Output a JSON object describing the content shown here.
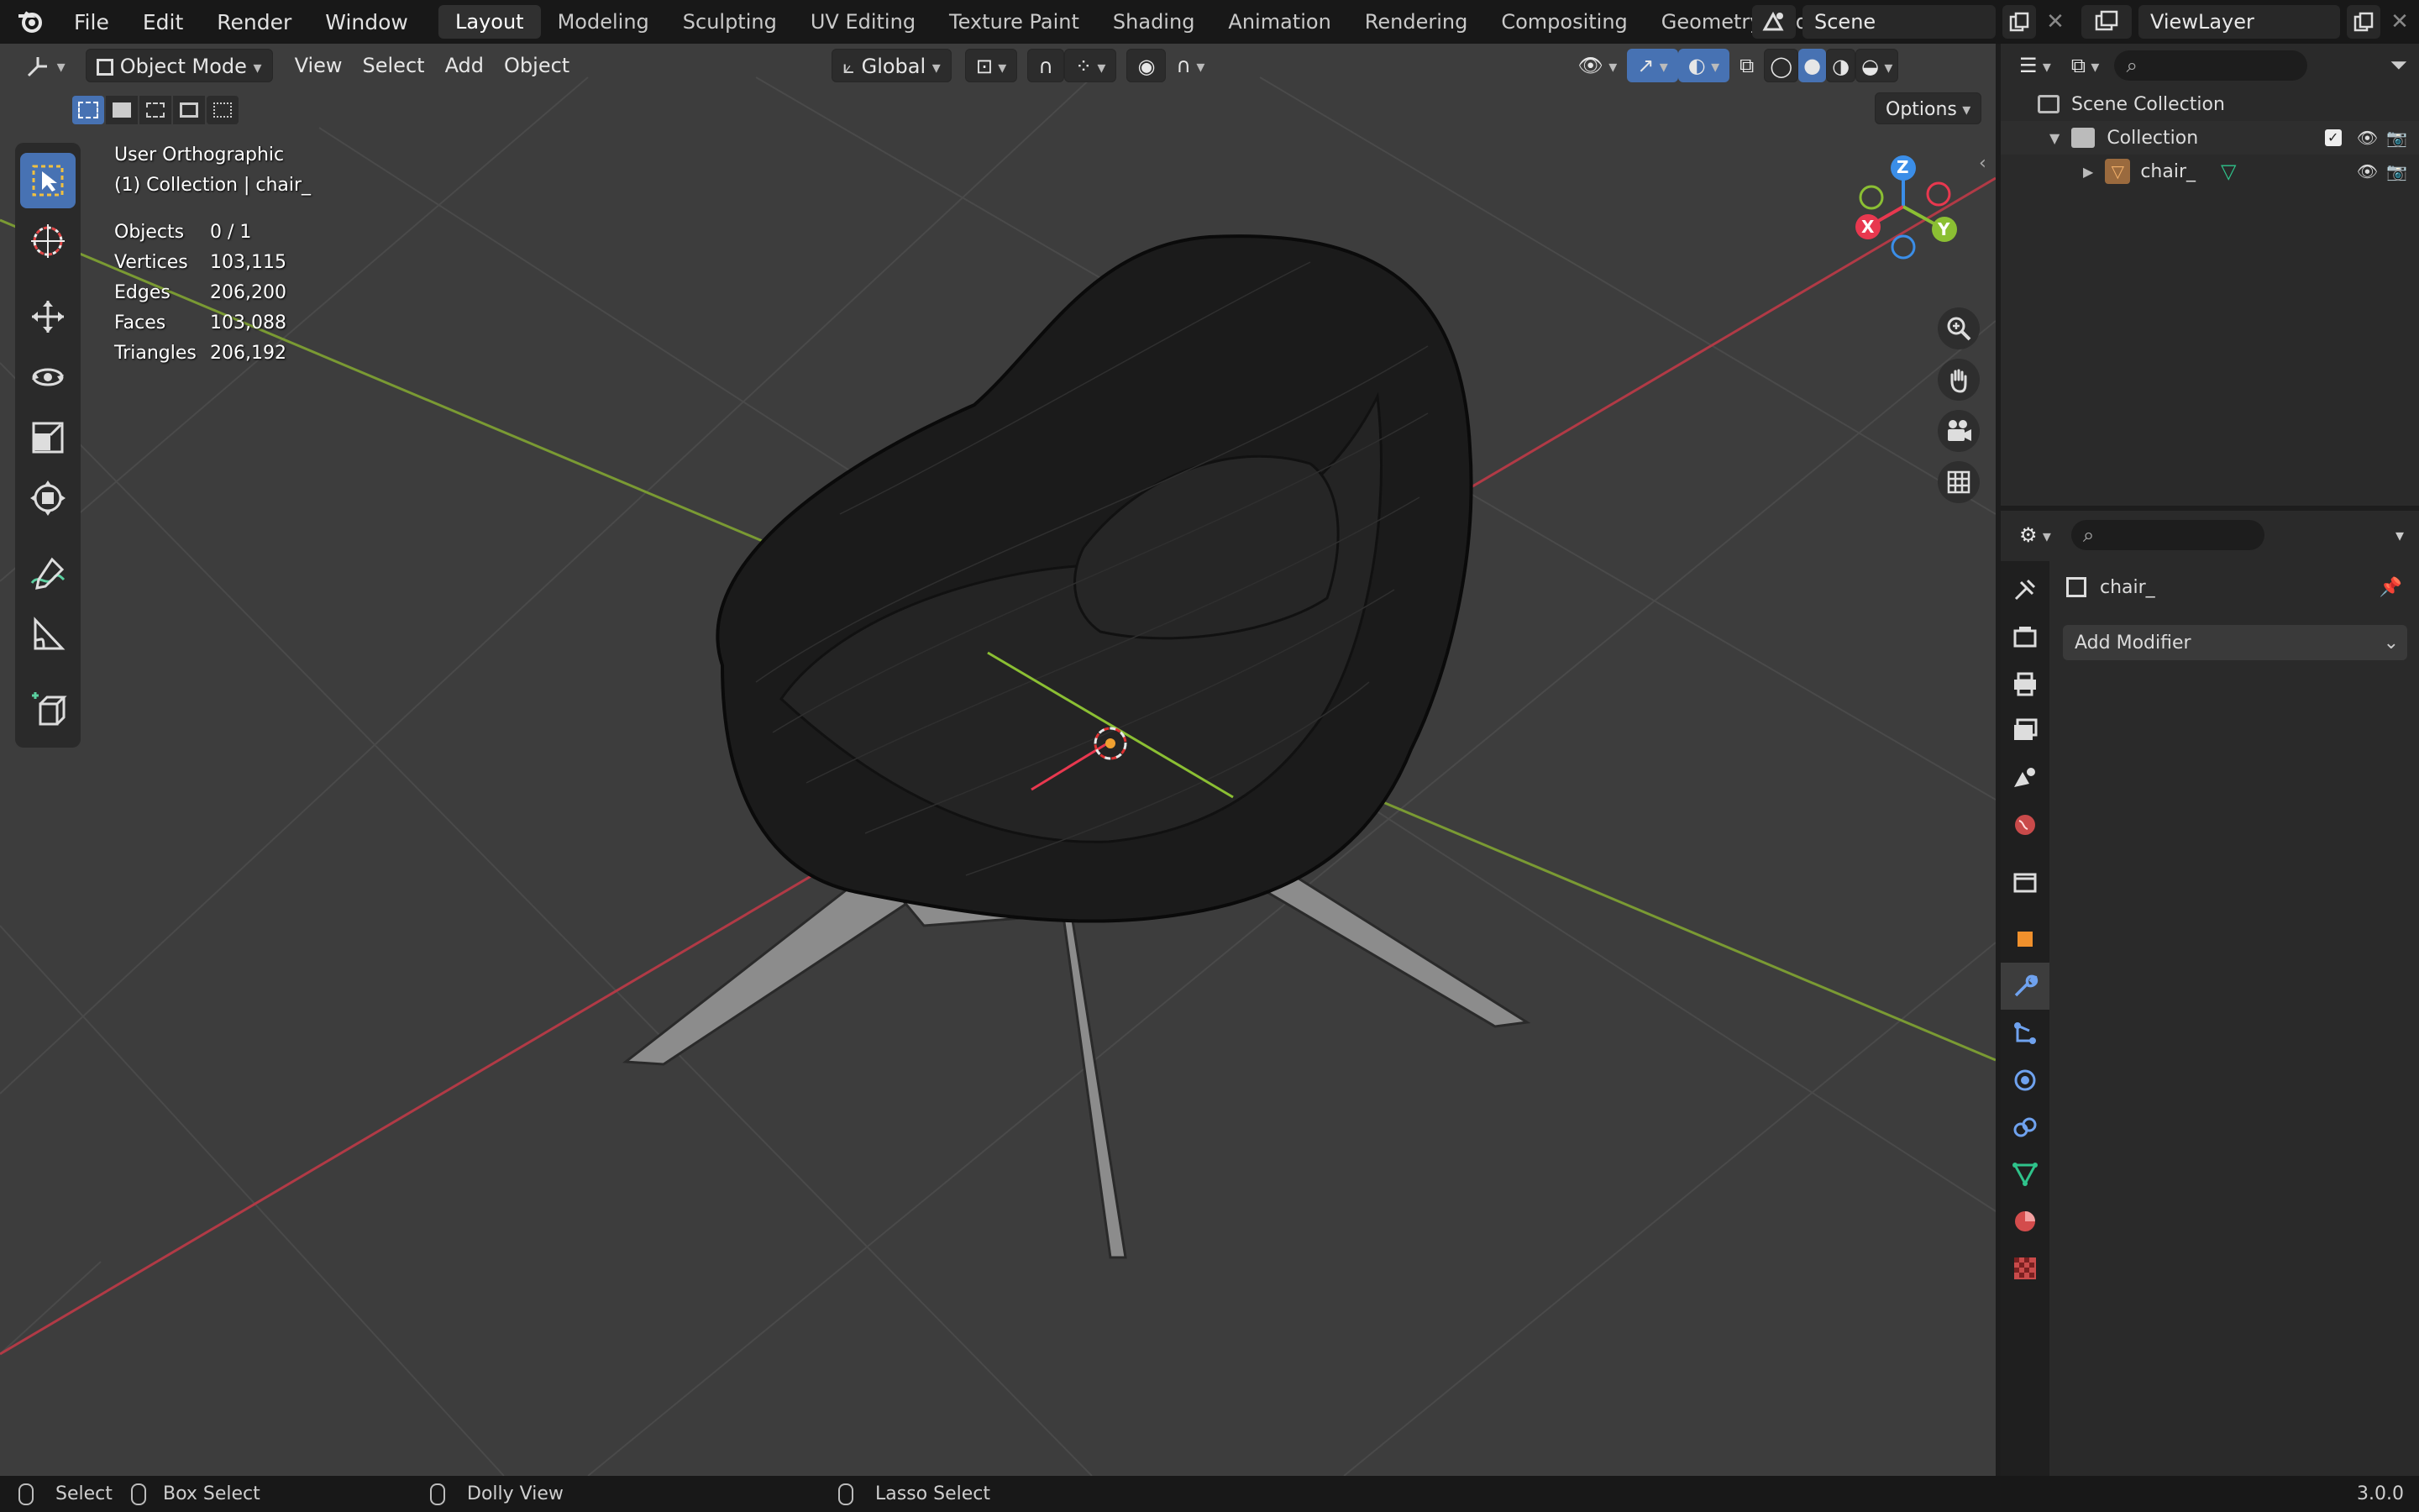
{
  "topbar": {
    "menu": [
      "File",
      "Edit",
      "Render",
      "Window",
      "Help"
    ],
    "workspaces": [
      "Layout",
      "Modeling",
      "Sculpting",
      "UV Editing",
      "Texture Paint",
      "Shading",
      "Animation",
      "Rendering",
      "Compositing",
      "Geometry Nodes",
      "S"
    ],
    "active_workspace": "Layout",
    "scene": "Scene",
    "view_layer": "ViewLayer"
  },
  "viewport_header": {
    "mode": "Object Mode",
    "menus": [
      "View",
      "Select",
      "Add",
      "Object"
    ],
    "orientation": "Global",
    "options_label": "Options"
  },
  "overlay": {
    "view_name": "User Orthographic",
    "context": "(1) Collection | chair_",
    "stats": [
      {
        "label": "Objects",
        "value": "0 / 1"
      },
      {
        "label": "Vertices",
        "value": "103,115"
      },
      {
        "label": "Edges",
        "value": "206,200"
      },
      {
        "label": "Faces",
        "value": "103,088"
      },
      {
        "label": "Triangles",
        "value": "206,192"
      }
    ]
  },
  "gizmo": {
    "x": "X",
    "y": "Y",
    "z": "Z"
  },
  "outliner": {
    "root": "Scene Collection",
    "collection": "Collection",
    "object": "chair_"
  },
  "properties": {
    "object_name": "chair_",
    "add_modifier": "Add Modifier"
  },
  "statusbar": {
    "select": "Select",
    "box_select": "Box Select",
    "dolly": "Dolly View",
    "lasso": "Lasso Select",
    "version": "3.0.0"
  },
  "colors": {
    "accent": "#4772b3",
    "x_axis": "#e8384f",
    "y_axis": "#8bbf33",
    "z_axis": "#3b8ee8"
  }
}
